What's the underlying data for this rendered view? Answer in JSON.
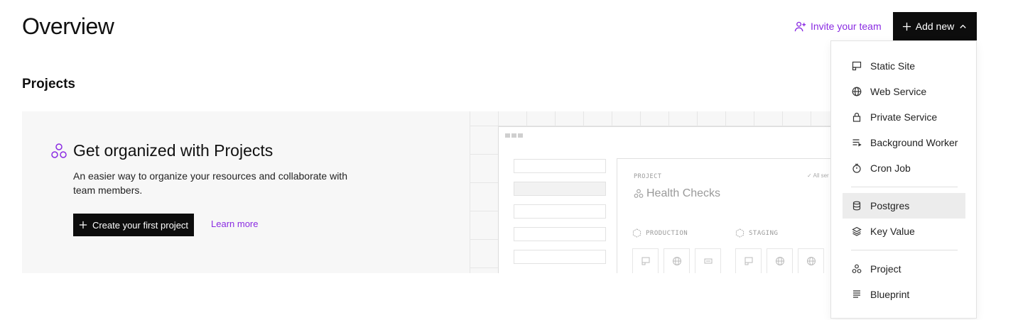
{
  "header": {
    "title": "Overview",
    "invite_label": "Invite your team",
    "add_new_label": "Add new"
  },
  "projects": {
    "section_title": "Projects",
    "banner": {
      "heading": "Get organized with Projects",
      "description": "An easier way to organize your resources and collaborate with team members.",
      "create_button": "Create your first project",
      "learn_more": "Learn more"
    },
    "illustration": {
      "project_label": "PROJECT",
      "project_name": "Health Checks",
      "all_services": "✓ All ser",
      "env_production": "PRODUCTION",
      "env_staging": "STAGING"
    }
  },
  "add_new_menu": {
    "items": [
      {
        "label": "Static Site",
        "icon": "static-site-icon"
      },
      {
        "label": "Web Service",
        "icon": "globe-icon"
      },
      {
        "label": "Private Service",
        "icon": "lock-icon"
      },
      {
        "label": "Background Worker",
        "icon": "worker-icon"
      },
      {
        "label": "Cron Job",
        "icon": "timer-icon"
      },
      {
        "label": "Postgres",
        "icon": "database-icon"
      },
      {
        "label": "Key Value",
        "icon": "layers-icon"
      },
      {
        "label": "Project",
        "icon": "project-icon"
      },
      {
        "label": "Blueprint",
        "icon": "blueprint-icon"
      }
    ],
    "hovered": "Postgres"
  },
  "colors": {
    "accent": "#8a2be2",
    "button_dark": "#0d0d0d",
    "banner_bg": "#f7f7f7",
    "menu_hover": "#ececec"
  }
}
